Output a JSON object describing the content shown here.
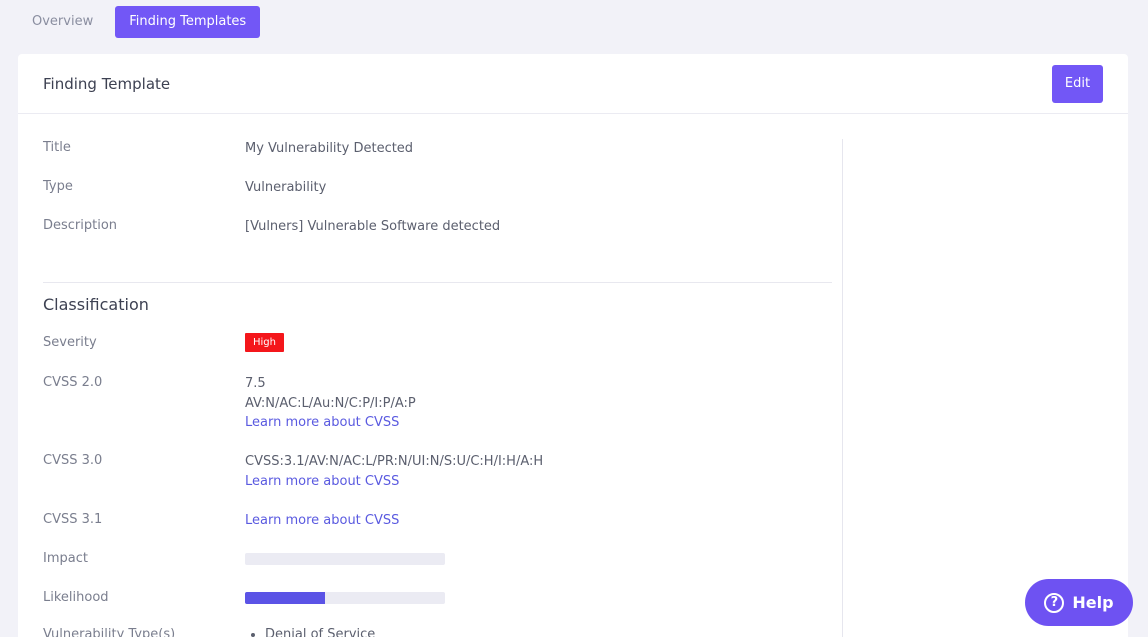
{
  "tabs": [
    {
      "label": "Overview",
      "active": false
    },
    {
      "label": "Finding Templates",
      "active": true
    }
  ],
  "card": {
    "title": "Finding Template",
    "edit_label": "Edit"
  },
  "fields": {
    "title": {
      "label": "Title",
      "value": "My Vulnerability Detected"
    },
    "type": {
      "label": "Type",
      "value": "Vulnerability"
    },
    "description": {
      "label": "Description",
      "value": "[Vulners] Vulnerable Software detected"
    }
  },
  "classification": {
    "section_title": "Classification",
    "severity": {
      "label": "Severity",
      "value": "High",
      "color": "#f4161b"
    },
    "cvss20": {
      "label": "CVSS 2.0",
      "score": "7.5",
      "vector": "AV:N/AC:L/Au:N/C:P/I:P/A:P",
      "link": "Learn more about CVSS"
    },
    "cvss30": {
      "label": "CVSS 3.0",
      "vector": "CVSS:3.1/AV:N/AC:L/PR:N/UI:N/S:U/C:H/I:H/A:H",
      "link": "Learn more about CVSS"
    },
    "cvss31": {
      "label": "CVSS 3.1",
      "link": "Learn more about CVSS"
    },
    "impact": {
      "label": "Impact",
      "level": 0
    },
    "likelihood": {
      "label": "Likelihood",
      "level": 0.4
    },
    "vuln_types": {
      "label": "Vulnerability Type(s)",
      "items": [
        "Denial of Service"
      ]
    }
  },
  "help": {
    "label": "Help",
    "icon": "question-circle-icon"
  },
  "colors": {
    "accent": "#7257f6",
    "bar_fill": "#5b53e6",
    "background": "#f2f2f8"
  }
}
